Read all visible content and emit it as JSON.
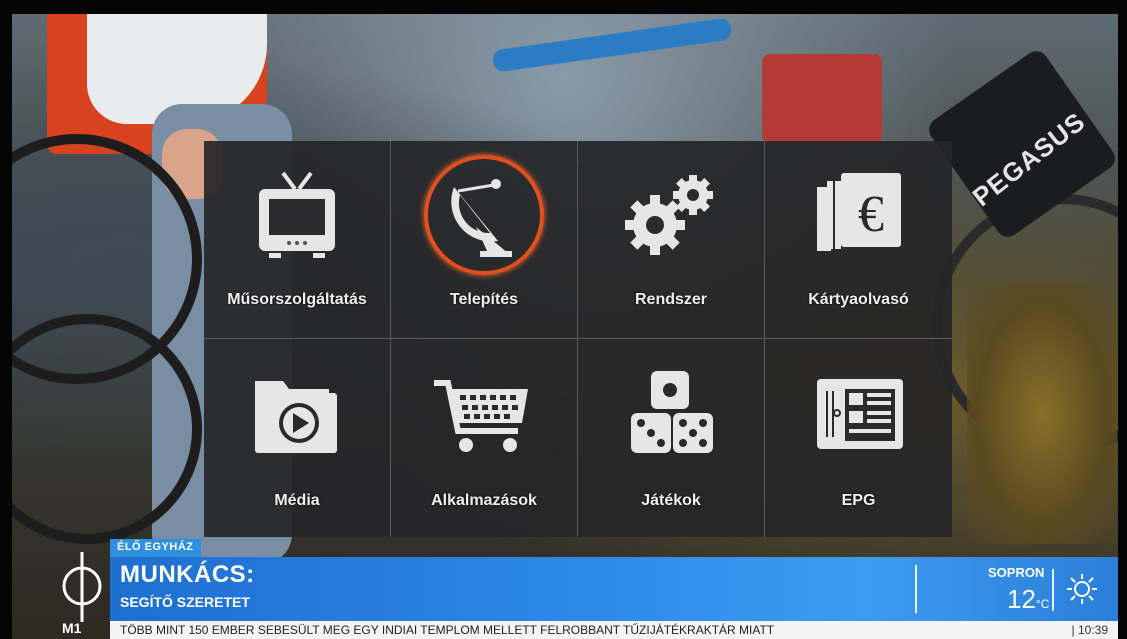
{
  "menu": {
    "items": [
      {
        "label": "Műsorszolgáltatás",
        "icon": "tv-icon",
        "selected": false
      },
      {
        "label": "Telepítés",
        "icon": "satellite-dish-icon",
        "selected": true
      },
      {
        "label": "Rendszer",
        "icon": "gears-icon",
        "selected": false
      },
      {
        "label": "Kártyaolvasó",
        "icon": "euro-cards-icon",
        "selected": false
      },
      {
        "label": "Média",
        "icon": "media-folder-icon",
        "selected": false
      },
      {
        "label": "Alkalmazások",
        "icon": "shopping-cart-icon",
        "selected": false
      },
      {
        "label": "Játékok",
        "icon": "dice-icon",
        "selected": false
      },
      {
        "label": "EPG",
        "icon": "epg-guide-icon",
        "selected": false
      }
    ],
    "accent_color": "#e0501f"
  },
  "broadcast": {
    "tag": "ÉLŐ EGYHÁZ",
    "title": "MUNKÁCS:",
    "subtitle": "SEGÍTŐ SZERETET",
    "weather_city": "SOPRON",
    "weather_temp": "12",
    "weather_unit": "°C",
    "weather_icon": "sun-icon",
    "channel_logo": "M1",
    "ticker_text": "TÖBB MINT 150 EMBER SEBESÜLT MEG EGY INDIAI TEMPLOM MELLETT FELROBBANT TŰZIJÁTÉKRAKTÁR MIATT",
    "clock": "| 10:39",
    "brand_color": "#2a84e6"
  },
  "background": {
    "bike_brand": "PEGASUS"
  }
}
